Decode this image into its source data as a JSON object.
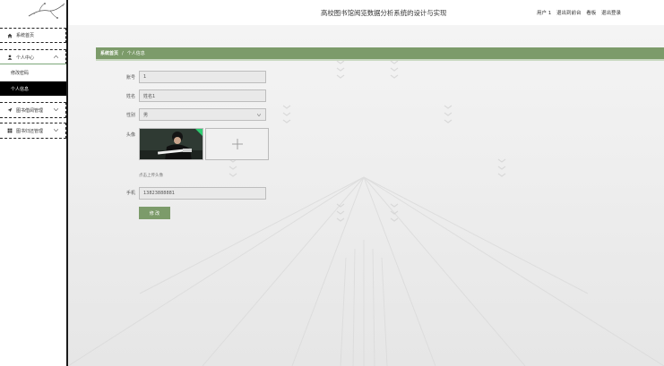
{
  "app": {
    "title": "高校图书馆阅览数据分析系统的设计与实现"
  },
  "header": {
    "links": [
      "用户 1",
      "退出到前台",
      "看板",
      "退出登录"
    ]
  },
  "sidebar": {
    "items": [
      {
        "label": "系统首页",
        "icon": "home-icon"
      },
      {
        "label": "个人中心",
        "icon": "user-icon",
        "expanded": true
      },
      {
        "label": "图书借阅管理",
        "icon": "send-icon"
      },
      {
        "label": "图书归还管理",
        "icon": "grid-icon"
      }
    ],
    "sub_items": [
      {
        "label": "修改密码",
        "active": false
      },
      {
        "label": "个人信息",
        "active": true
      }
    ]
  },
  "breadcrumb": {
    "home": "系统首页",
    "separator": "/",
    "current": "个人信息"
  },
  "form": {
    "account": {
      "label": "账号",
      "value": "1"
    },
    "name": {
      "label": "姓名",
      "value": "姓名1"
    },
    "gender": {
      "label": "性别",
      "value": "男"
    },
    "avatar": {
      "label": "头像",
      "upload_hint": "点击上传头像"
    },
    "phone": {
      "label": "手机",
      "value": "13823888881"
    },
    "submit_label": "修 改"
  },
  "colors": {
    "accent": "#7c9b6a",
    "active_bg": "#000000",
    "sidebar_bg": "#ffffff"
  }
}
